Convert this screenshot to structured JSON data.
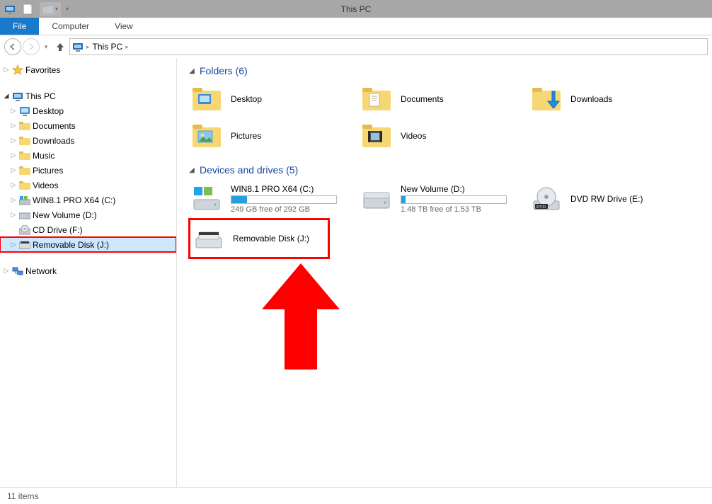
{
  "window": {
    "title": "This PC"
  },
  "ribbon": {
    "file": "File",
    "tabs": [
      "Computer",
      "View"
    ]
  },
  "address": {
    "path": "This PC"
  },
  "tree": {
    "favorites": "Favorites",
    "thispc": "This PC",
    "thispc_children": [
      "Desktop",
      "Documents",
      "Downloads",
      "Music",
      "Pictures",
      "Videos",
      "WIN8.1 PRO X64 (C:)",
      "New Volume (D:)",
      "CD Drive (F:)",
      "Removable Disk (J:)"
    ],
    "network": "Network"
  },
  "groups": {
    "folders": {
      "label": "Folders (6)",
      "items": [
        "Desktop",
        "Documents",
        "Downloads",
        "Pictures",
        "Videos"
      ]
    },
    "drives": {
      "label": "Devices and drives (5)",
      "items": [
        {
          "name": "WIN8.1 PRO X64 (C:)",
          "sub": "249 GB free of 292 GB",
          "fill": 15
        },
        {
          "name": "New Volume (D:)",
          "sub": "1.48 TB free of 1.53 TB",
          "fill": 4
        },
        {
          "name": "DVD RW Drive (E:)",
          "sub": "",
          "type": "dvd"
        },
        {
          "name": "Removable Disk (J:)",
          "sub": "",
          "type": "removable",
          "highlighted": true
        }
      ]
    }
  },
  "status": {
    "count": "11 items"
  }
}
